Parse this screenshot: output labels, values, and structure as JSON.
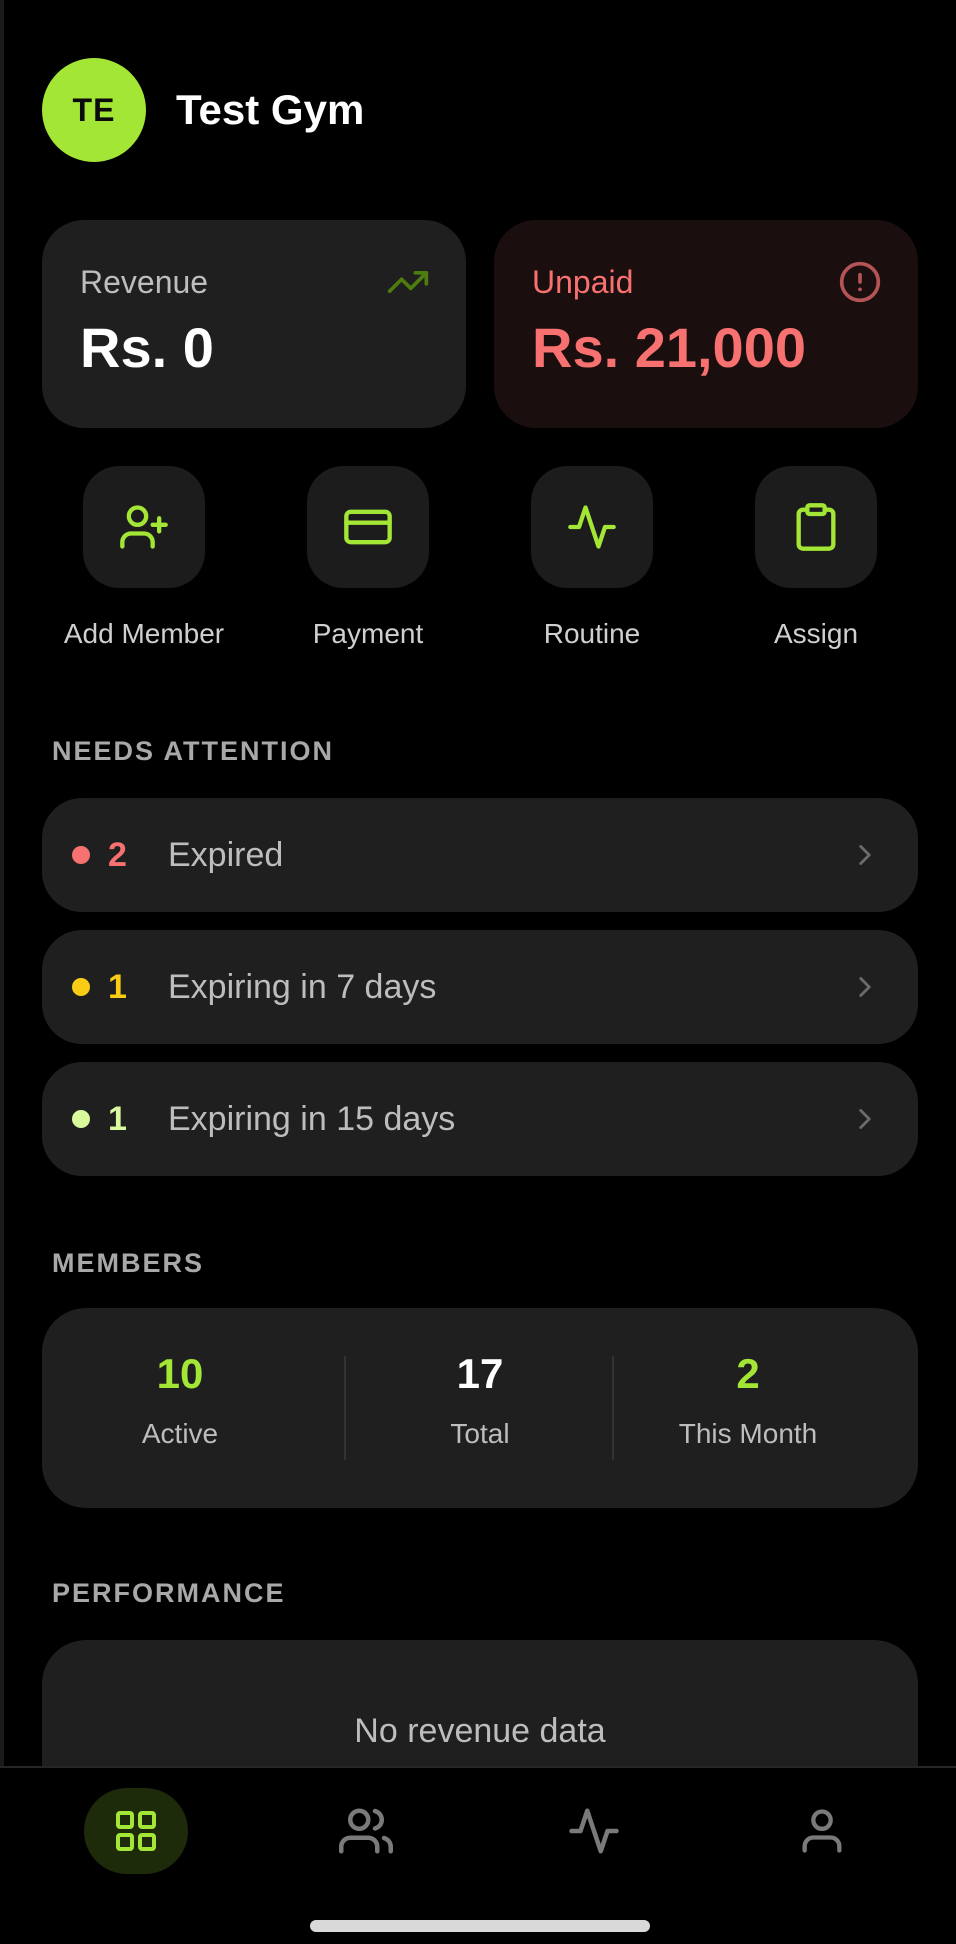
{
  "header": {
    "avatar_initials": "TE",
    "gym_name": "Test Gym"
  },
  "stats": {
    "revenue": {
      "label": "Revenue",
      "value": "Rs. 0",
      "icon": "trending-up-icon"
    },
    "unpaid": {
      "label": "Unpaid",
      "value": "Rs. 21,000",
      "icon": "alert-circle-icon"
    }
  },
  "actions": [
    {
      "label": "Add Member",
      "icon": "user-plus-icon"
    },
    {
      "label": "Payment",
      "icon": "credit-card-icon"
    },
    {
      "label": "Routine",
      "icon": "activity-icon"
    },
    {
      "label": "Assign",
      "icon": "clipboard-icon"
    }
  ],
  "attention": {
    "title": "NEEDS ATTENTION",
    "items": [
      {
        "count": "2",
        "label": "Expired",
        "color": "#f87171"
      },
      {
        "count": "1",
        "label": "Expiring in 7 days",
        "color": "#facc15"
      },
      {
        "count": "1",
        "label": "Expiring in 15 days",
        "color": "#d9f99d"
      }
    ]
  },
  "members": {
    "title": "MEMBERS",
    "stats": [
      {
        "value": "10",
        "label": "Active",
        "color": "#a3e635"
      },
      {
        "value": "17",
        "label": "Total",
        "color": "#ffffff"
      },
      {
        "value": "2",
        "label": "This Month",
        "color": "#a3e635"
      }
    ]
  },
  "performance": {
    "title": "PERFORMANCE",
    "empty_text": "No revenue data"
  },
  "tabs": [
    {
      "icon": "grid-icon",
      "active": true
    },
    {
      "icon": "users-icon",
      "active": false
    },
    {
      "icon": "activity-icon",
      "active": false
    },
    {
      "icon": "user-icon",
      "active": false
    }
  ],
  "colors": {
    "accent": "#a3e635",
    "danger": "#f87171",
    "card": "#1f1f1f",
    "background": "#000000"
  }
}
